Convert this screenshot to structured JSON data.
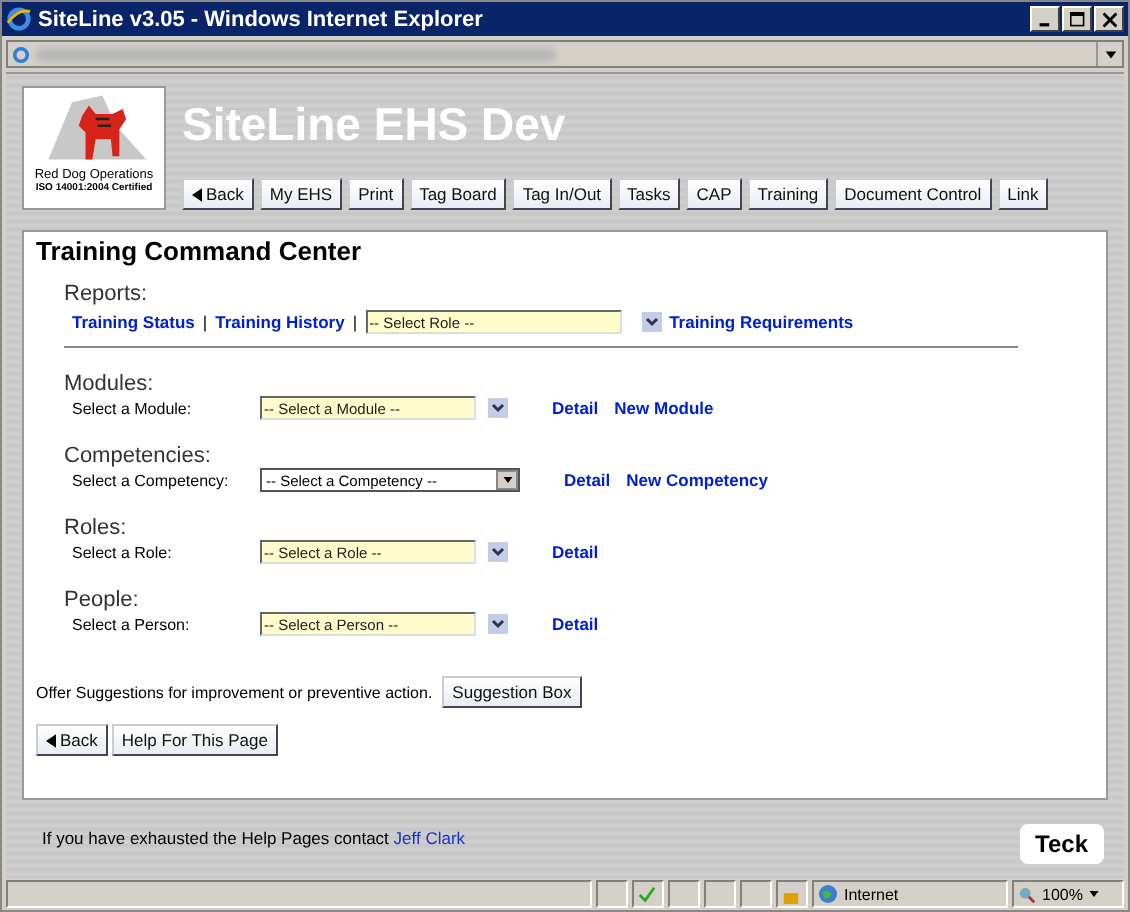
{
  "window": {
    "title": "SiteLine v3.05 - Windows Internet Explorer"
  },
  "header": {
    "title": "SiteLine EHS Dev",
    "logo": {
      "line1": "Red Dog Operations",
      "line2": "ISO 14001:2004 Certified"
    }
  },
  "nav_buttons": [
    {
      "label": "Back",
      "kind": "back"
    },
    {
      "label": "My EHS",
      "kind": "plain"
    },
    {
      "label": "Print",
      "kind": "plain"
    },
    {
      "label": "Tag Board",
      "kind": "plain"
    },
    {
      "label": "Tag In/Out",
      "kind": "plain"
    },
    {
      "label": "Tasks",
      "kind": "plain"
    },
    {
      "label": "CAP",
      "kind": "plain"
    },
    {
      "label": "Training",
      "kind": "plain"
    },
    {
      "label": "Document Control",
      "kind": "plain"
    },
    {
      "label": "Link",
      "kind": "plain"
    }
  ],
  "page_title": "Training Command Center",
  "reports": {
    "heading": "Reports:",
    "links": [
      "Training Status",
      "Training History"
    ],
    "separator": "|",
    "role_select": {
      "placeholder": "-- Select Role --"
    },
    "requirements_link": "Training Requirements"
  },
  "sections": [
    {
      "heading": "Modules:",
      "label": "Select a Module:",
      "select": {
        "placeholder": "-- Select a Module --",
        "kind": "combo"
      },
      "links": [
        "Detail",
        "New Module"
      ]
    },
    {
      "heading": "Competencies:",
      "label": "Select a Competency:",
      "select": {
        "placeholder": "-- Select a Competency --",
        "kind": "native"
      },
      "links": [
        "Detail",
        "New Competency"
      ]
    },
    {
      "heading": "Roles:",
      "label": "Select a Role:",
      "select": {
        "placeholder": "-- Select a Role --",
        "kind": "combo"
      },
      "links": [
        "Detail"
      ]
    },
    {
      "heading": "People:",
      "label": "Select a Person:",
      "select": {
        "placeholder": "-- Select a Person --",
        "kind": "combo"
      },
      "links": [
        "Detail"
      ]
    }
  ],
  "suggestion": {
    "text": "Offer Suggestions for improvement or preventive action.",
    "button": "Suggestion Box"
  },
  "bottom_buttons": [
    {
      "label": "Back",
      "kind": "back"
    },
    {
      "label": "Help For This Page",
      "kind": "plain"
    }
  ],
  "footer": {
    "text": "If you have exhausted the Help Pages contact",
    "link": "Jeff Clark"
  },
  "brand": "Teck",
  "status_bar": {
    "zone": "Internet",
    "zoom": "100%"
  }
}
